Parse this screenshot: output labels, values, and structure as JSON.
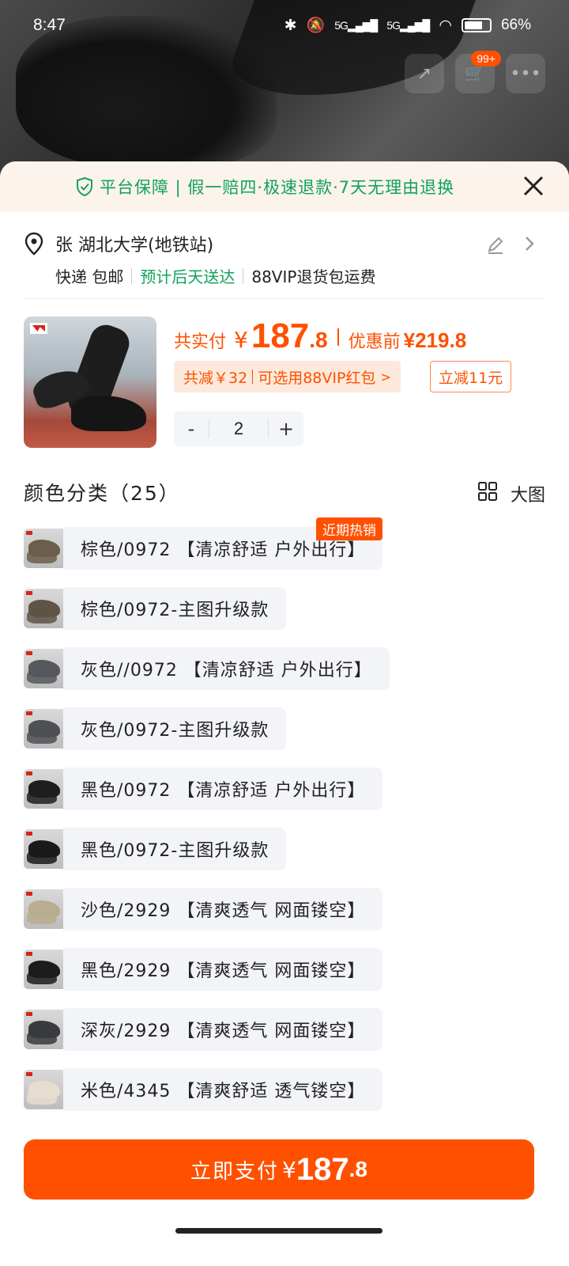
{
  "status_bar": {
    "time": "8:47",
    "network": "5G",
    "battery": "66"
  },
  "header": {
    "cart_badge": "99+"
  },
  "guarantee": {
    "text": "平台保障 | 假一赔四·极速退款·7天无理由退换"
  },
  "address": {
    "name": "张 湖北大学(地铁站)",
    "shipping": "快递 包邮",
    "estimate": "预计后天送达",
    "vip": "88VIP退货包运费"
  },
  "product": {
    "pay_label": "共实付",
    "currency": "¥",
    "price_int": "187",
    "price_dec": ".8",
    "before_label": "优惠前",
    "before_price": "¥219.8",
    "promo_reduce": "共减￥32",
    "promo_redpack": "可选用88VIP红包",
    "instant_discount": "立减11元",
    "quantity": "2",
    "minus": "-",
    "plus": "+"
  },
  "category": {
    "title": "颜色分类（25）",
    "big_label": "大图"
  },
  "variants": [
    {
      "label": "棕色/0972 【清凉舒适 户外出行】",
      "badge": "近期热销",
      "thumb_color": "#6b5e4a"
    },
    {
      "label": "棕色/0972-主图升级款",
      "thumb_color": "#5f5446"
    },
    {
      "label": "灰色//0972 【清凉舒适 户外出行】",
      "thumb_color": "#55585c"
    },
    {
      "label": "灰色/0972-主图升级款",
      "thumb_color": "#4e5054"
    },
    {
      "label": "黑色/0972 【清凉舒适 户外出行】",
      "thumb_color": "#1e1e1e"
    },
    {
      "label": "黑色/0972-主图升级款",
      "thumb_color": "#1a1a1a"
    },
    {
      "label": "沙色/2929 【清爽透气  网面镂空】",
      "thumb_color": "#b9ad8f"
    },
    {
      "label": "黑色/2929 【清爽透气  网面镂空】",
      "thumb_color": "#1c1c1c"
    },
    {
      "label": "深灰/2929 【清爽透气  网面镂空】",
      "thumb_color": "#3a3b3e"
    },
    {
      "label": "米色/4345 【清爽舒适  透气镂空】",
      "thumb_color": "#e6ddcf"
    }
  ],
  "pay_button": {
    "label": "立即支付",
    "currency": "¥",
    "price_int": "187",
    "price_dec": ".8"
  },
  "colors": {
    "accent": "#ff5000",
    "green": "#10a35a"
  }
}
